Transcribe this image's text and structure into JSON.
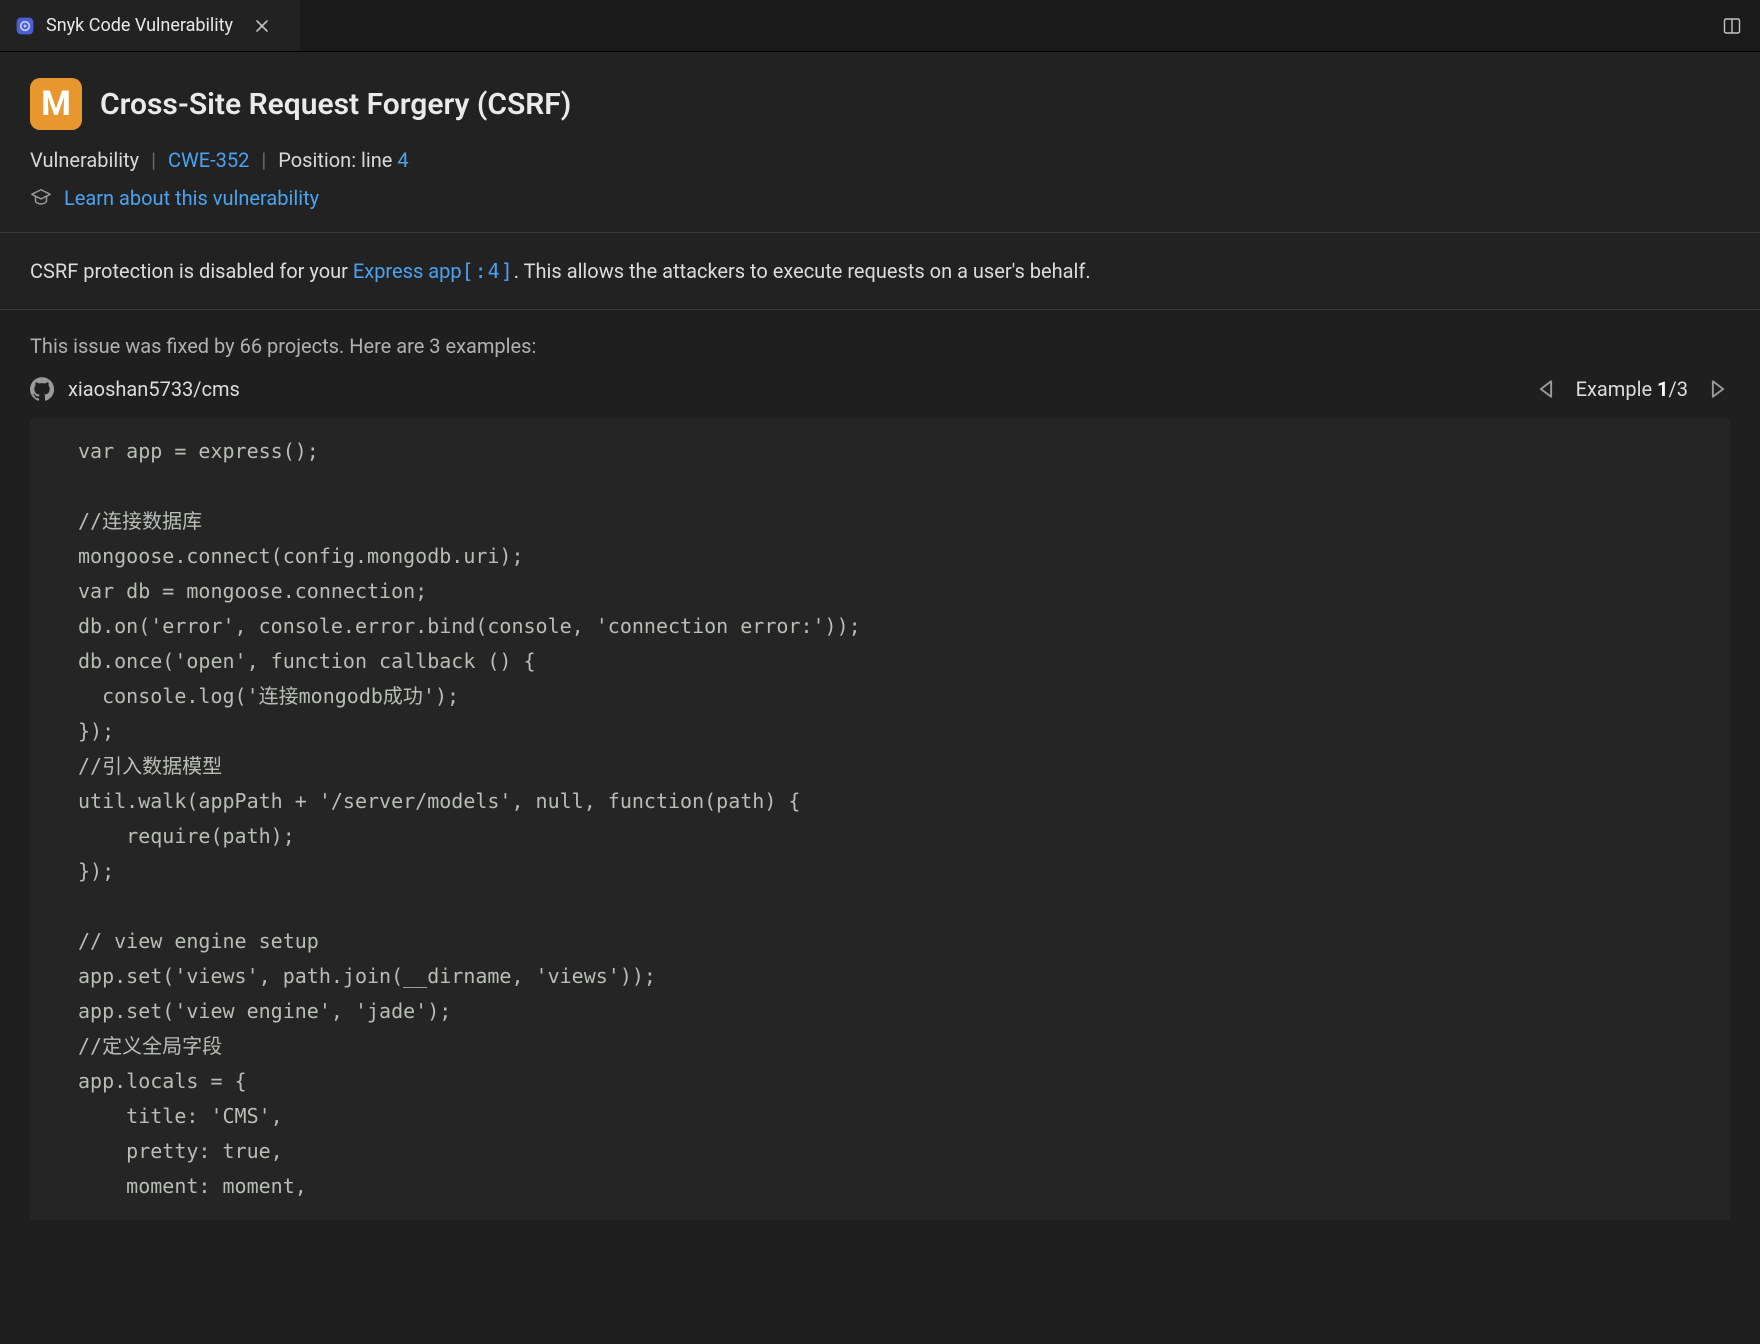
{
  "tab": {
    "title": "Snyk Code Vulnerability"
  },
  "header": {
    "severity_letter": "M",
    "title": "Cross-Site Request Forgery (CSRF)",
    "type_label": "Vulnerability",
    "cwe": "CWE-352",
    "position_prefix": "Position: line ",
    "position_line": "4",
    "learn_label": "Learn about this vulnerability"
  },
  "description": {
    "prefix": "CSRF protection is disabled for your ",
    "link_text": "Express app",
    "source_ref": "[:4]",
    "suffix": ". This allows the attackers to execute requests on a user's behalf."
  },
  "examples": {
    "lead": "This issue was fixed by 66 projects. Here are 3 examples:",
    "repo": "xiaoshan5733/cms",
    "pager_label": "Example ",
    "pager_current": "1",
    "pager_total": "/3",
    "code": "var app = express();\n\n//连接数据库\nmongoose.connect(config.mongodb.uri);\nvar db = mongoose.connection;\ndb.on('error', console.error.bind(console, 'connection error:'));\ndb.once('open', function callback () {\n  console.log('连接mongodb成功');\n});\n//引入数据模型\nutil.walk(appPath + '/server/models', null, function(path) {\n    require(path);\n});\n\n// view engine setup\napp.set('views', path.join(__dirname, 'views'));\napp.set('view engine', 'jade');\n//定义全局字段\napp.locals = {\n    title: 'CMS',\n    pretty: true,\n    moment: moment,"
  }
}
